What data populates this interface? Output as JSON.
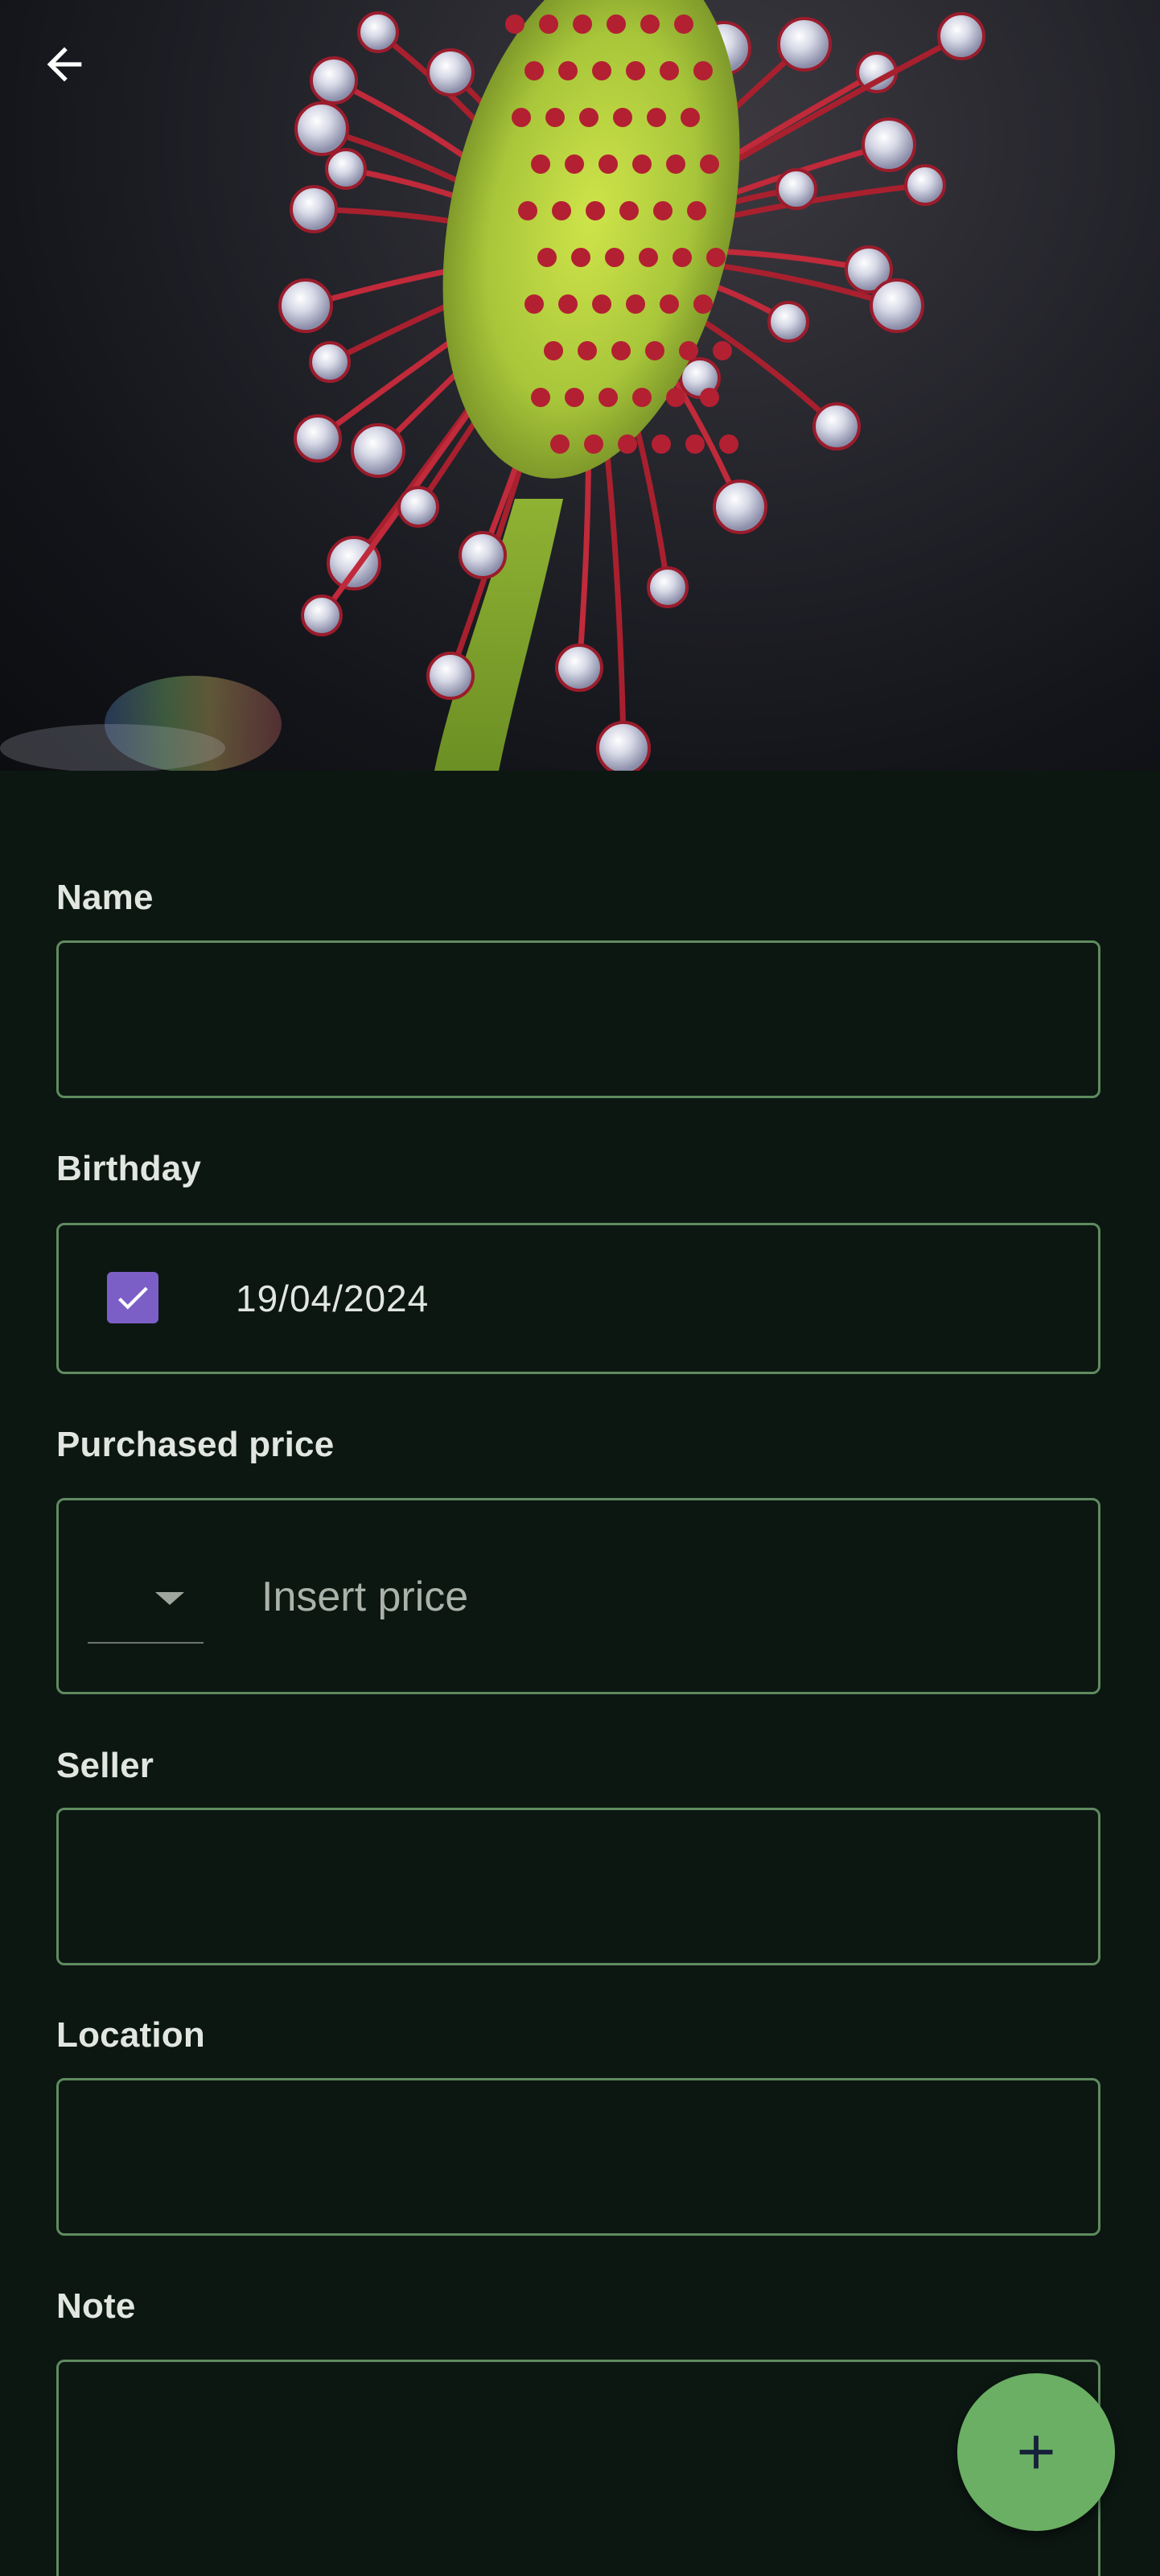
{
  "hero": {
    "back_icon": "arrow-left-icon"
  },
  "form": {
    "name": {
      "label": "Name",
      "value": ""
    },
    "birthday": {
      "label": "Birthday",
      "checked": true,
      "value": "19/04/2024"
    },
    "purchased_price": {
      "label": "Purchased price",
      "currency": "",
      "placeholder": "Insert price"
    },
    "seller": {
      "label": "Seller",
      "value": ""
    },
    "location": {
      "label": "Location",
      "value": ""
    },
    "note": {
      "label": "Note",
      "value": ""
    }
  },
  "fab": {
    "icon": "plus-icon"
  },
  "colors": {
    "background": "#0c1712",
    "field_border": "#5f8b5f",
    "checkbox": "#7c5fc6",
    "fab": "#6aaf63"
  }
}
